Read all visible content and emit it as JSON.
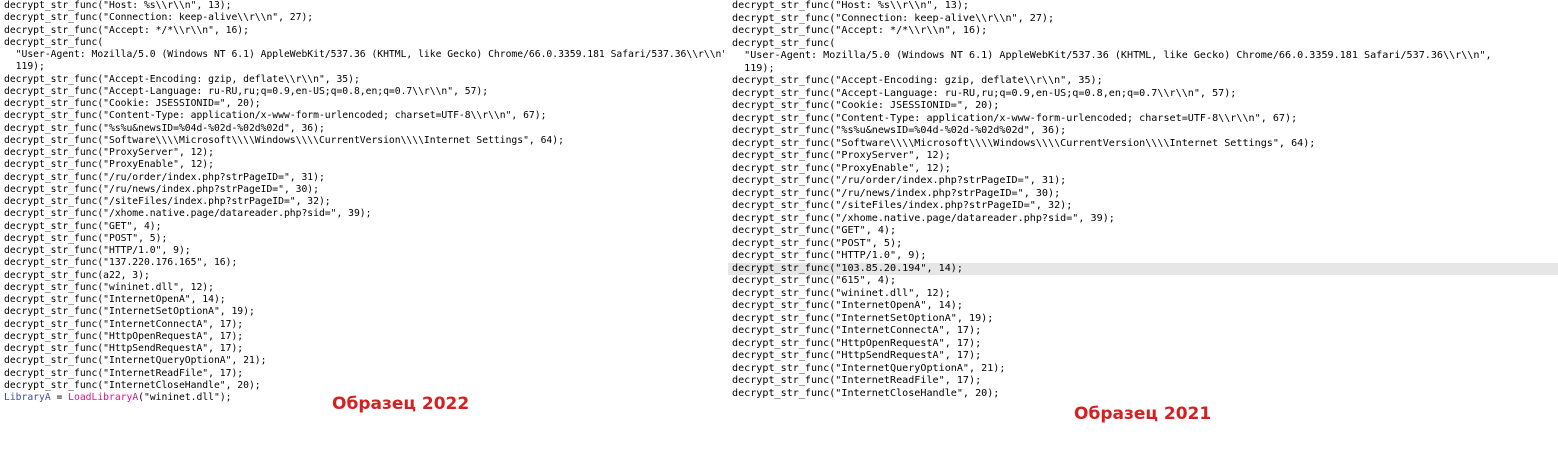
{
  "colors": {
    "label_red": "#d42020",
    "highlight_bg": "#e6e6e6",
    "keyword_pink": "#e0148a",
    "variable_blue": "#3b4ea8"
  },
  "panel_left": {
    "lines": [
      "decrypt_str_func(\"Host: %s\\\\r\\\\n\", 13);",
      "decrypt_str_func(\"Connection: keep-alive\\\\r\\\\n\", 27);",
      "decrypt_str_func(\"Accept: */*\\\\r\\\\n\", 16);",
      "decrypt_str_func(",
      "  \"User-Agent: Mozilla/5.0 (Windows NT 6.1) AppleWebKit/537.36 (KHTML, like Gecko) Chrome/66.0.3359.181 Safari/537.36\\\\r\\\\n\",",
      "  119);",
      "decrypt_str_func(\"Accept-Encoding: gzip, deflate\\\\r\\\\n\", 35);",
      "decrypt_str_func(\"Accept-Language: ru-RU,ru;q=0.9,en-US;q=0.8,en;q=0.7\\\\r\\\\n\", 57);",
      "decrypt_str_func(\"Cookie: JSESSIONID=\", 20);",
      "decrypt_str_func(\"Content-Type: application/x-www-form-urlencoded; charset=UTF-8\\\\r\\\\n\", 67);",
      "decrypt_str_func(\"%s%u&newsID=%04d-%02d-%02d%02d\", 36);",
      "decrypt_str_func(\"Software\\\\\\\\Microsoft\\\\\\\\Windows\\\\\\\\CurrentVersion\\\\\\\\Internet Settings\", 64);",
      "decrypt_str_func(\"ProxyServer\", 12);",
      "decrypt_str_func(\"ProxyEnable\", 12);",
      "decrypt_str_func(\"/ru/order/index.php?strPageID=\", 31);",
      "decrypt_str_func(\"/ru/news/index.php?strPageID=\", 30);",
      "decrypt_str_func(\"/siteFiles/index.php?strPageID=\", 32);",
      "decrypt_str_func(\"/xhome.native.page/datareader.php?sid=\", 39);",
      "decrypt_str_func(\"GET\", 4);",
      "decrypt_str_func(\"POST\", 5);",
      "decrypt_str_func(\"HTTP/1.0\", 9);",
      "decrypt_str_func(\"137.220.176.165\", 16);",
      "decrypt_str_func(a22, 3);",
      "decrypt_str_func(\"wininet.dll\", 12);",
      "decrypt_str_func(\"InternetOpenA\", 14);",
      "decrypt_str_func(\"InternetSetOptionA\", 19);",
      "decrypt_str_func(\"InternetConnectA\", 17);",
      "decrypt_str_func(\"HttpOpenRequestA\", 17);",
      "decrypt_str_func(\"HttpSendRequestA\", 17);",
      "decrypt_str_func(\"InternetQueryOptionA\", 21);",
      "decrypt_str_func(\"InternetReadFile\", 17);",
      "decrypt_str_func(\"InternetCloseHandle\", 20);"
    ],
    "last_line": {
      "var": "LibraryA",
      "op": " = ",
      "fn": "LoadLibraryA",
      "args": "(\"wininet.dll\");"
    },
    "sample_label": "Образец 2022"
  },
  "panel_right": {
    "lines": [
      "decrypt_str_func(\"Host: %s\\\\r\\\\n\", 13);",
      "decrypt_str_func(\"Connection: keep-alive\\\\r\\\\n\", 27);",
      "decrypt_str_func(\"Accept: */*\\\\r\\\\n\", 16);",
      "decrypt_str_func(",
      "  \"User-Agent: Mozilla/5.0 (Windows NT 6.1) AppleWebKit/537.36 (KHTML, like Gecko) Chrome/66.0.3359.181 Safari/537.36\\\\r\\\\n\",",
      "  119);",
      "decrypt_str_func(\"Accept-Encoding: gzip, deflate\\\\r\\\\n\", 35);",
      "decrypt_str_func(\"Accept-Language: ru-RU,ru;q=0.9,en-US;q=0.8,en;q=0.7\\\\r\\\\n\", 57);",
      "decrypt_str_func(\"Cookie: JSESSIONID=\", 20);",
      "decrypt_str_func(\"Content-Type: application/x-www-form-urlencoded; charset=UTF-8\\\\r\\\\n\", 67);",
      "decrypt_str_func(\"%s%u&newsID=%04d-%02d-%02d%02d\", 36);",
      "decrypt_str_func(\"Software\\\\\\\\Microsoft\\\\\\\\Windows\\\\\\\\CurrentVersion\\\\\\\\Internet Settings\", 64);",
      "decrypt_str_func(\"ProxyServer\", 12);",
      "decrypt_str_func(\"ProxyEnable\", 12);",
      "decrypt_str_func(\"/ru/order/index.php?strPageID=\", 31);",
      "decrypt_str_func(\"/ru/news/index.php?strPageID=\", 30);",
      "decrypt_str_func(\"/siteFiles/index.php?strPageID=\", 32);",
      "decrypt_str_func(\"/xhome.native.page/datareader.php?sid=\", 39);",
      "decrypt_str_func(\"GET\", 4);",
      "decrypt_str_func(\"POST\", 5);",
      "decrypt_str_func(\"HTTP/1.0\", 9);",
      "decrypt_str_func(\"103.85.20.194\", 14);",
      "decrypt_str_func(\"615\", 4);",
      "decrypt_str_func(\"wininet.dll\", 12);",
      "decrypt_str_func(\"InternetOpenA\", 14);",
      "decrypt_str_func(\"InternetSetOptionA\", 19);",
      "decrypt_str_func(\"InternetConnectA\", 17);",
      "decrypt_str_func(\"HttpOpenRequestA\", 17);",
      "decrypt_str_func(\"HttpSendRequestA\", 17);",
      "decrypt_str_func(\"InternetQueryOptionA\", 21);",
      "decrypt_str_func(\"InternetReadFile\", 17);",
      "decrypt_str_func(\"InternetCloseHandle\", 20);"
    ],
    "highlighted_line": 21,
    "sample_label": "Образец 2021"
  }
}
